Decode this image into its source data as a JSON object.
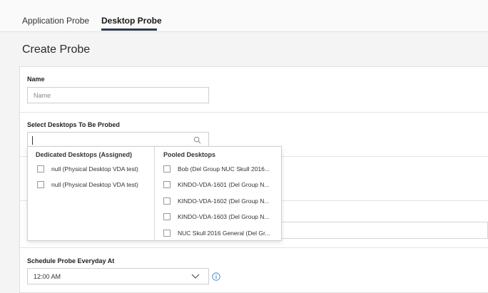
{
  "tabs": [
    {
      "label": "Application Probe"
    },
    {
      "label": "Desktop Probe"
    }
  ],
  "page": {
    "title": "Create Probe"
  },
  "form": {
    "name_label": "Name",
    "name_placeholder": "Name",
    "desktops_label": "Select Desktops To Be Probed",
    "schedule_label": "Schedule Probe Everyday At",
    "schedule_value": "12:00 AM"
  },
  "dropdown": {
    "dedicated_title": "Dedicated Desktops (Assigned)",
    "dedicated": [
      "null (Physical Desktop VDA test)",
      "null (Physical Desktop VDA test)"
    ],
    "pooled_title": "Pooled Desktops",
    "pooled": [
      "Bob (Del Group NUC Skull 2016...",
      "KINDO-VDA-1601 (Del Group N...",
      "KINDO-VDA-1602 (Del Group N...",
      "KINDO-VDA-1603 (Del Group N...",
      "NUC Skull 2016 General (Del Gr..."
    ]
  },
  "icons": {
    "search": "search-icon",
    "chevron": "chevron-down-icon",
    "info": "info-icon"
  },
  "colors": {
    "accent": "#2f3a4a",
    "info": "#4a90d9"
  }
}
